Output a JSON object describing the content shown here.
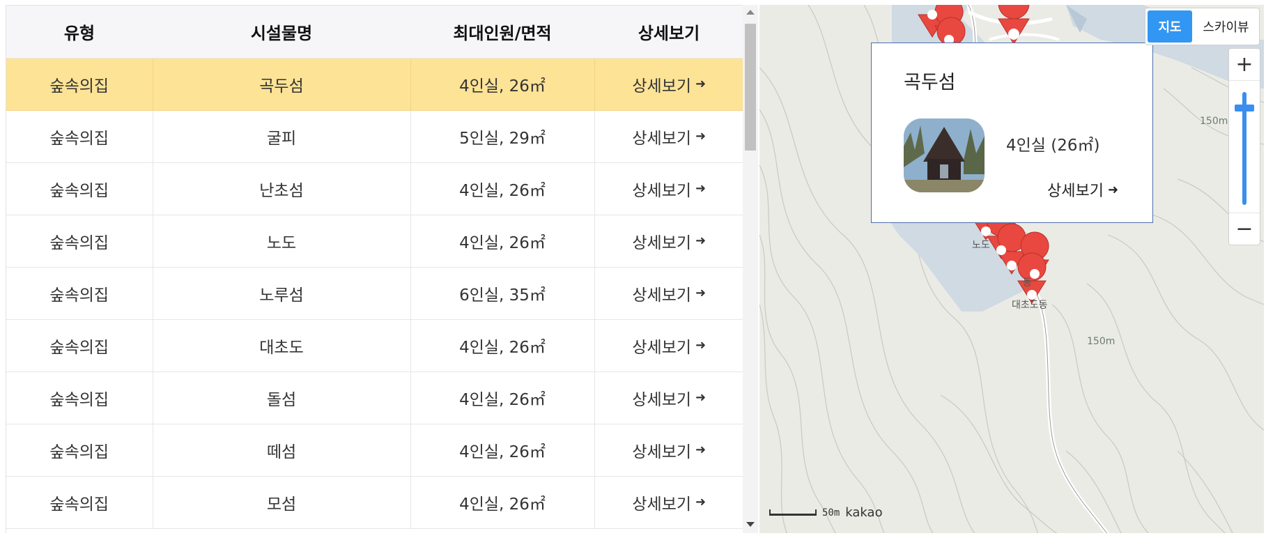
{
  "table": {
    "headers": [
      "유형",
      "시설물명",
      "최대인원/면적",
      "상세보기"
    ],
    "rows": [
      {
        "type": "숲속의집",
        "name": "곡두섬",
        "capacity": "4인실, 26㎡",
        "detail": "상세보기"
      },
      {
        "type": "숲속의집",
        "name": "굴피",
        "capacity": "5인실, 29㎡",
        "detail": "상세보기"
      },
      {
        "type": "숲속의집",
        "name": "난초섬",
        "capacity": "4인실, 26㎡",
        "detail": "상세보기"
      },
      {
        "type": "숲속의집",
        "name": "노도",
        "capacity": "4인실, 26㎡",
        "detail": "상세보기"
      },
      {
        "type": "숲속의집",
        "name": "노루섬",
        "capacity": "6인실, 35㎡",
        "detail": "상세보기"
      },
      {
        "type": "숲속의집",
        "name": "대초도",
        "capacity": "4인실, 26㎡",
        "detail": "상세보기"
      },
      {
        "type": "숲속의집",
        "name": "돌섬",
        "capacity": "4인실, 26㎡",
        "detail": "상세보기"
      },
      {
        "type": "숲속의집",
        "name": "떼섬",
        "capacity": "4인실, 26㎡",
        "detail": "상세보기"
      },
      {
        "type": "숲속의집",
        "name": "모섬",
        "capacity": "4인실, 26㎡",
        "detail": "상세보기"
      }
    ],
    "active_row_color": "#fde396"
  },
  "map": {
    "map_type": {
      "map": "지도",
      "skyview": "스카이뷰"
    },
    "zoom": {
      "in": "+",
      "out": "−"
    },
    "info_window": {
      "title": "곡두섬",
      "caption": "4인실 (26㎡)",
      "link": "상세보기"
    },
    "labels": {
      "contour_1": "150m",
      "contour_2": "150m",
      "place_1": "노도",
      "place_2": "대초도동",
      "place_3": "동"
    },
    "scale": {
      "distance": "50m",
      "brand": "kakao"
    },
    "marker_color": "#e8483f",
    "accent": "#3296f3"
  }
}
